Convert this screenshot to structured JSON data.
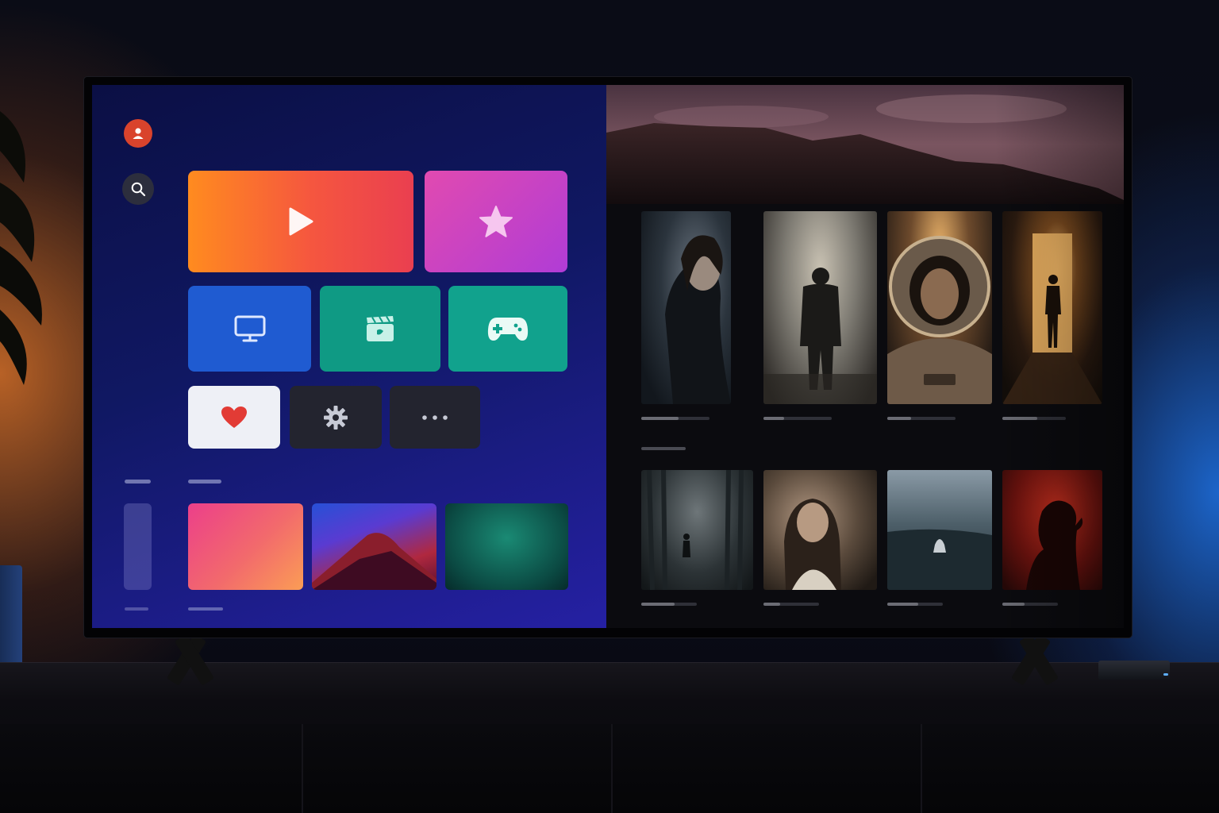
{
  "launcher": {
    "profile": {
      "icon": "user-icon",
      "color": "#d9432c"
    },
    "search": {
      "icon": "search-icon"
    },
    "apps": [
      {
        "id": "play",
        "icon": "play-icon"
      },
      {
        "id": "favorites-star",
        "icon": "star-icon"
      },
      {
        "id": "live-tv",
        "icon": "monitor-icon"
      },
      {
        "id": "movies",
        "icon": "clapperboard-icon"
      },
      {
        "id": "games",
        "icon": "gamepad-icon"
      },
      {
        "id": "liked",
        "icon": "heart-icon"
      },
      {
        "id": "settings",
        "icon": "gear-icon"
      },
      {
        "id": "more",
        "icon": "more-dots-icon"
      }
    ],
    "accent_colors": {
      "play": "#f5563f",
      "star": "#c143c4",
      "tv": "#1f5bd1",
      "teal": "#11a28d",
      "heart": "#e23b35"
    }
  },
  "browse": {
    "row1": [
      {
        "progress": 0.55
      },
      {
        "progress": 0.3
      },
      {
        "progress": 0.35
      },
      {
        "progress": 0.55
      }
    ],
    "row2": [
      {
        "progress": 0.6
      },
      {
        "progress": 0.3
      },
      {
        "progress": 0.55
      },
      {
        "progress": 0.4
      }
    ]
  }
}
